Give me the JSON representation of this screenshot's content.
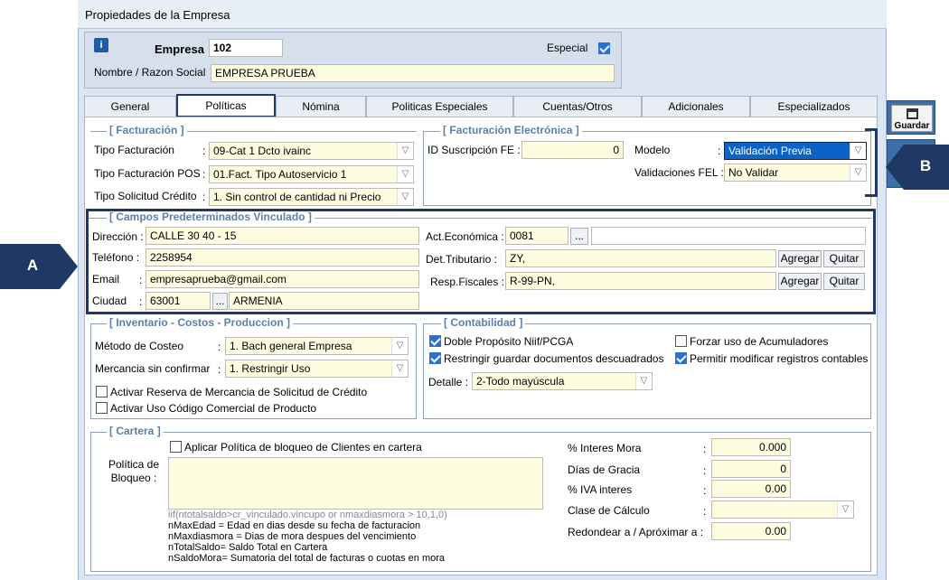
{
  "window_title": "Propiedades de la Empresa",
  "header": {
    "empresa_label": "Empresa",
    "empresa_value": "102",
    "especial_label": "Especial",
    "especial_checked": true,
    "razon_label": "Nombre / Razon Social",
    "razon_value": "EMPRESA PRUEBA"
  },
  "tabs": [
    {
      "label": "General"
    },
    {
      "label": "Políticas"
    },
    {
      "label": "Nómina"
    },
    {
      "label": "Politicas Especiales"
    },
    {
      "label": "Cuentas/Otros"
    },
    {
      "label": "Adicionales"
    },
    {
      "label": "Especializados"
    }
  ],
  "side": {
    "guardar_label": "Guardar"
  },
  "annotations": {
    "a": "A",
    "b": "B"
  },
  "facturacion": {
    "title": "[ Facturación ]",
    "tipo_label": "Tipo Facturación",
    "tipo_value": "09-Cat 1 Dcto ivainc",
    "pos_label": "Tipo Facturación POS",
    "pos_value": "01.Fact. Tipo Autoservicio 1",
    "credito_label": "Tipo Solicitud Crédito",
    "credito_value": "1. Sin control de cantidad  ni Precio"
  },
  "fe": {
    "title": "[ Facturación Electrónica ]",
    "id_label": "ID Suscripción FE :",
    "id_value": "0",
    "modelo_label": "Modelo",
    "modelo_value": "Validación Previa",
    "val_label": "Validaciones FEL :",
    "val_value": "No Validar"
  },
  "campos": {
    "title": "[ Campos Predeterminados Vinculado ]",
    "dir_label": "Dirección :",
    "dir_value": "CALLE 30 40 - 15",
    "tel_label": "Teléfono :",
    "tel_value": "2258954",
    "email_label": "Email",
    "email_value": "empresaprueba@gmail.com",
    "ciudad_label": "Ciudad",
    "ciudad_code": "63001",
    "ciudad_name": "ARMENIA",
    "act_label": "Act.Económica :",
    "act_value": "0081",
    "det_label": "Det.Tributario :",
    "det_value": "ZY,",
    "resp_label": "Resp.Fiscales :",
    "resp_value": "R-99-PN,",
    "agregar": "Agregar",
    "quitar": "Quitar",
    "dots": "..."
  },
  "inventario": {
    "title": "[ Inventario - Costos - Produccion ]",
    "metodo_label": "Método de Costeo",
    "metodo_value": "1. Bach general Empresa",
    "merc_label": "Mercancia sin confirmar",
    "merc_value": "1. Restringir Uso",
    "cb1": "Activar Reserva de Mercancia de Solicitud de Crédito",
    "cb2": "Activar Uso Código Comercial de Producto"
  },
  "contabilidad": {
    "title": "[ Contabilidad ]",
    "cb1": "Doble Propósito Niif/PCGA",
    "cb2": "Forzar uso de Acumuladores",
    "cb3": "Restringir guardar documentos descuadrados",
    "cb4": "Permitir modificar registros contables",
    "detalle_label": "Detalle :",
    "detalle_value": "2-Todo mayúscula"
  },
  "cartera": {
    "title": "[ Cartera ]",
    "cb_label": "Aplicar Política de bloqueo de Clientes en cartera",
    "politica_label": "Política de Bloqueo :",
    "formula": "iif(ntotalsaldo>cr_vinculado.vincupo or nmaxdiasmora > 10,1,0)",
    "help1": "nMaxEdad = Edad en dias desde su fecha de facturacion",
    "help2": "nMaxdiasmora = Dias de mora despues del vencimiento",
    "help3": "nTotalSaldo= Saldo Total en Cartera",
    "help4": "nSaldoMora= Sumatoria del total de facturas o cuotas en mora",
    "interes_label": "% Interes Mora",
    "interes_value": "0.000",
    "gracia_label": "Días de Gracia",
    "gracia_value": "0",
    "iva_label": "% IVA interes",
    "iva_value": "0.00",
    "clase_label": "Clase de Cálculo",
    "clase_value": "",
    "redondear_label": "Redondear a / Apróximar a :",
    "redondear_value": "0.00",
    "colon": ":"
  }
}
